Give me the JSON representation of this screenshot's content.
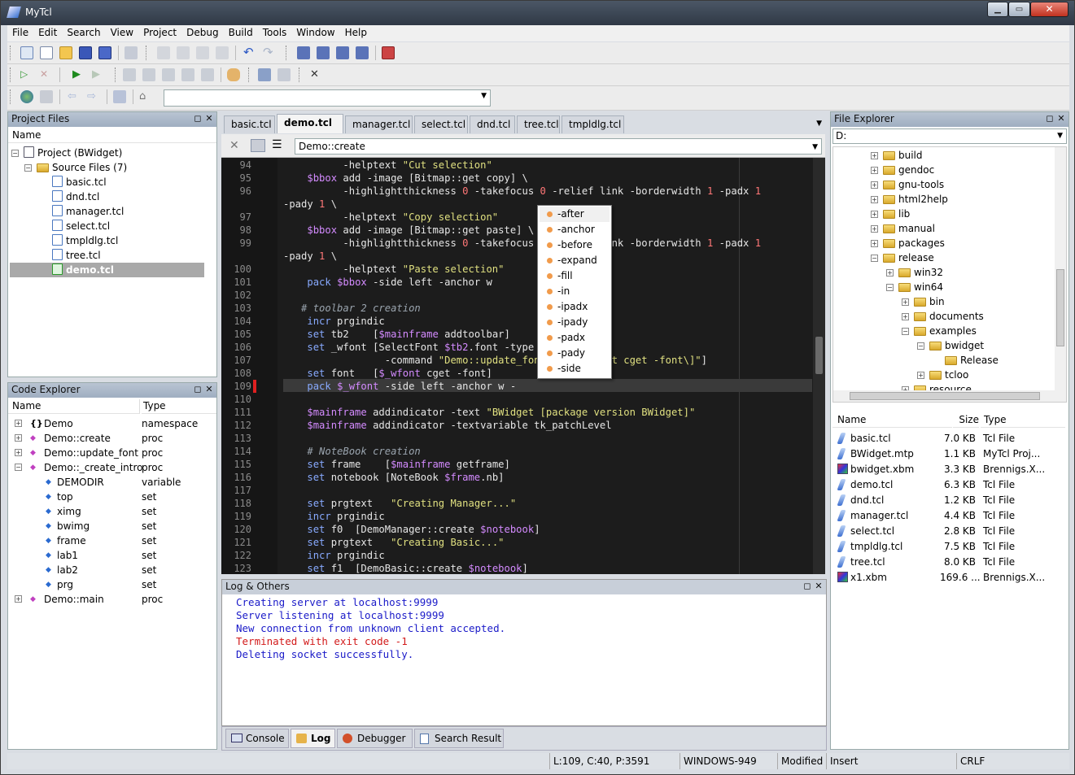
{
  "app": {
    "title": "MyTcl"
  },
  "menu": [
    "File",
    "Edit",
    "Search",
    "View",
    "Project",
    "Debug",
    "Build",
    "Tools",
    "Window",
    "Help"
  ],
  "project_panel": {
    "title": "Project Files",
    "column": "Name",
    "root": "Project (BWidget)",
    "group": "Source Files (7)",
    "files": [
      "basic.tcl",
      "dnd.tcl",
      "manager.tcl",
      "select.tcl",
      "tmpldlg.tcl",
      "tree.tcl",
      "demo.tcl"
    ]
  },
  "code_explorer": {
    "title": "Code Explorer",
    "col_name": "Name",
    "col_type": "Type",
    "rows": [
      {
        "name": "Demo",
        "type": "namespace"
      },
      {
        "name": "Demo::create",
        "type": "proc"
      },
      {
        "name": "Demo::update_font",
        "type": "proc"
      },
      {
        "name": "Demo::_create_intro",
        "type": "proc"
      },
      {
        "name": "DEMODIR",
        "type": "variable"
      },
      {
        "name": "top",
        "type": "set"
      },
      {
        "name": "ximg",
        "type": "set"
      },
      {
        "name": "bwimg",
        "type": "set"
      },
      {
        "name": "frame",
        "type": "set"
      },
      {
        "name": "lab1",
        "type": "set"
      },
      {
        "name": "lab2",
        "type": "set"
      },
      {
        "name": "prg",
        "type": "set"
      },
      {
        "name": "Demo::main",
        "type": "proc"
      }
    ]
  },
  "editor": {
    "tabs": [
      "basic.tcl",
      "demo.tcl",
      "manager.tcl",
      "select.tcl",
      "dnd.tcl",
      "tree.tcl",
      "tmpldlg.tcl"
    ],
    "active_tab": "demo.tcl",
    "proc_selector": "Demo::create",
    "line_numbers": [
      "94",
      "95",
      "96",
      "",
      "97",
      "98",
      "99",
      "",
      "100",
      "101",
      "102",
      "103",
      "104",
      "105",
      "106",
      "107",
      "108",
      "109",
      "110",
      "111",
      "112",
      "113",
      "114",
      "115",
      "116",
      "117",
      "118",
      "119",
      "120",
      "121",
      "122",
      "123"
    ]
  },
  "autocomplete": [
    "-after",
    "-anchor",
    "-before",
    "-expand",
    "-fill",
    "-in",
    "-ipadx",
    "-ipady",
    "-padx",
    "-pady",
    "-side"
  ],
  "log_panel": {
    "title": "Log & Others",
    "lines": [
      {
        "text": "Creating server at localhost:9999",
        "color": "#1a1ac8"
      },
      {
        "text": "Server listening at localhost:9999",
        "color": "#1a1ac8"
      },
      {
        "text": "New connection from unknown client accepted.",
        "color": "#1a1ac8"
      },
      {
        "text": "Terminated with exit code -1",
        "color": "#d21a1a"
      },
      {
        "text": "Deleting socket successfully.",
        "color": "#1a1ac8"
      }
    ],
    "tabs": [
      "Console",
      "Log",
      "Debugger",
      "Search Result"
    ]
  },
  "file_explorer": {
    "title": "File Explorer",
    "drive": "D:",
    "tree": [
      "build",
      "gendoc",
      "gnu-tools",
      "html2help",
      "lib",
      "manual",
      "packages",
      "release",
      "win32",
      "win64",
      "bin",
      "documents",
      "examples",
      "bwidget",
      "Release",
      "tcloo",
      "resource"
    ],
    "col_name": "Name",
    "col_size": "Size",
    "col_type": "Type",
    "files": [
      {
        "name": "basic.tcl",
        "size": "7.0 KB",
        "type": "Tcl File"
      },
      {
        "name": "BWidget.mtp",
        "size": "1.1 KB",
        "type": "MyTcl Proj..."
      },
      {
        "name": "bwidget.xbm",
        "size": "3.3 KB",
        "type": "Brennigs.X..."
      },
      {
        "name": "demo.tcl",
        "size": "6.3 KB",
        "type": "Tcl File"
      },
      {
        "name": "dnd.tcl",
        "size": "1.2 KB",
        "type": "Tcl File"
      },
      {
        "name": "manager.tcl",
        "size": "4.4 KB",
        "type": "Tcl File"
      },
      {
        "name": "select.tcl",
        "size": "2.8 KB",
        "type": "Tcl File"
      },
      {
        "name": "tmpldlg.tcl",
        "size": "7.5 KB",
        "type": "Tcl File"
      },
      {
        "name": "tree.tcl",
        "size": "8.0 KB",
        "type": "Tcl File"
      },
      {
        "name": "x1.xbm",
        "size": "169.6 ...",
        "type": "Brennigs.X..."
      }
    ]
  },
  "status": {
    "position": "L:109, C:40, P:3591",
    "encoding": "WINDOWS-949",
    "modified": "Modified",
    "mode": "Insert",
    "eol": "CRLF"
  }
}
